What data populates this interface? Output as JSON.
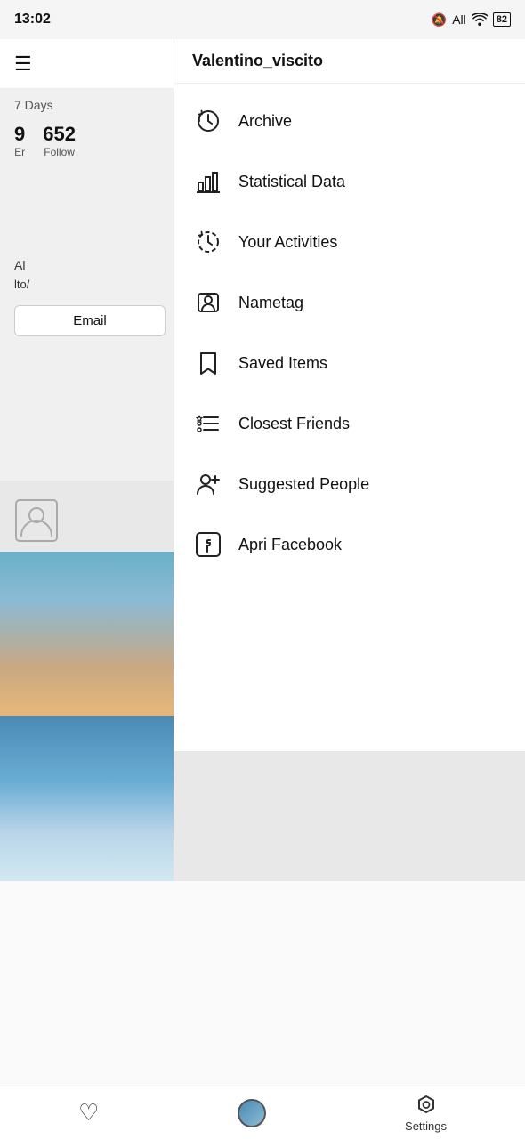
{
  "statusBar": {
    "time": "13:02",
    "network": "All",
    "battery": "82"
  },
  "profileHeader": {
    "hamburgerLabel": "☰",
    "username": "Valentino_viscito"
  },
  "profileStats": {
    "daysLabel": "7 Days",
    "stats": [
      {
        "number": "9",
        "label": "Er"
      },
      {
        "number": "652",
        "label": "Follow"
      }
    ]
  },
  "profileBody": {
    "alLabel": "Al",
    "linkLabel": "lto/",
    "emailButton": "Email"
  },
  "dropdown": {
    "username": "Valentino_viscito",
    "items": [
      {
        "id": "archive",
        "label": "Archive",
        "icon": "archive"
      },
      {
        "id": "statistical-data",
        "label": "Statistical Data",
        "icon": "bar-chart"
      },
      {
        "id": "your-activities",
        "label": "Your Activities",
        "icon": "activity"
      },
      {
        "id": "nametag",
        "label": "Nametag",
        "icon": "nametag"
      },
      {
        "id": "saved-items",
        "label": "Saved Items",
        "icon": "bookmark"
      },
      {
        "id": "closest-friends",
        "label": "Closest Friends",
        "icon": "list-star"
      },
      {
        "id": "suggested-people",
        "label": "Suggested People",
        "icon": "add-person"
      },
      {
        "id": "apri-facebook",
        "label": "Apri Facebook",
        "icon": "facebook"
      }
    ]
  },
  "bottomNav": {
    "items": [
      {
        "id": "heart",
        "icon": "♡",
        "label": ""
      },
      {
        "id": "profile",
        "icon": "avatar",
        "label": ""
      },
      {
        "id": "settings",
        "icon": "⬡",
        "label": "Settings"
      }
    ]
  }
}
